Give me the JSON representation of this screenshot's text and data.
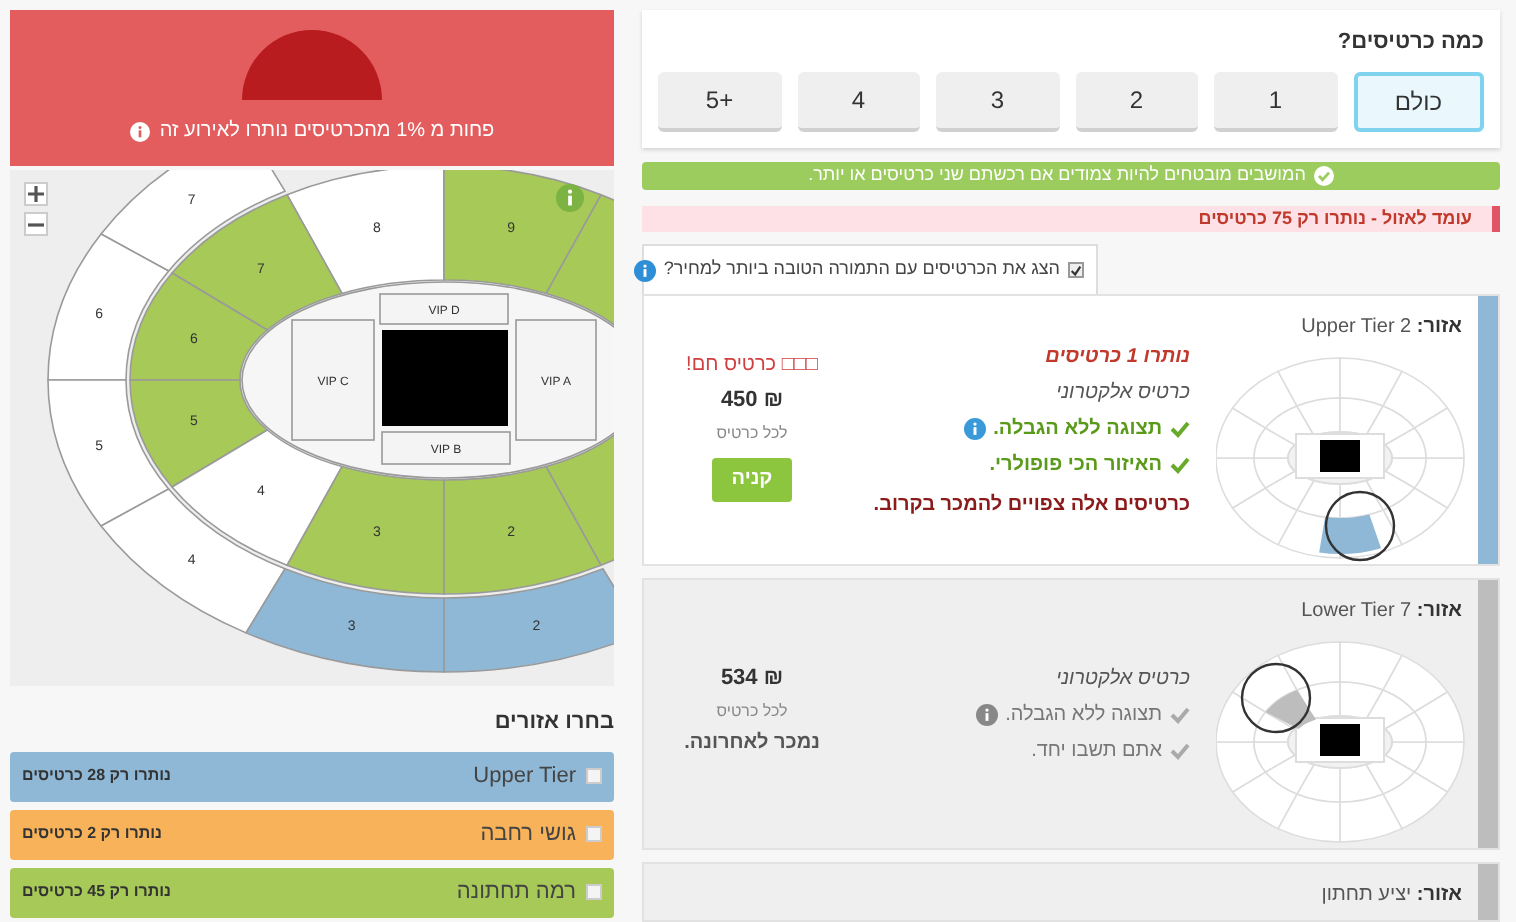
{
  "availability": {
    "text": "פחות מ 1% מהכרטיסים נותרו לאירוע זה"
  },
  "map": {
    "sections": [
      {
        "label": "7",
        "color": "#ffffff"
      },
      {
        "label": "8",
        "color": "#ffffff"
      },
      {
        "label": "9",
        "color": "#a6c957"
      },
      {
        "label": "7",
        "color": "#a6c957"
      },
      {
        "label": "6",
        "color": "#ffffff"
      },
      {
        "label": "6",
        "color": "#a6c957"
      },
      {
        "label": "5",
        "color": "#a6c957"
      },
      {
        "label": "5",
        "color": "#ffffff"
      },
      {
        "label": "4",
        "color": "#ffffff"
      },
      {
        "label": "3",
        "color": "#a6c957"
      },
      {
        "label": "2",
        "color": "#a6c957"
      },
      {
        "label": "4",
        "color": "#ffffff"
      },
      {
        "label": "3",
        "color": "#8fb8d6"
      },
      {
        "label": "2",
        "color": "#8fb8d6"
      }
    ],
    "partial_sections": [
      {
        "color": "#a6c957"
      },
      {
        "color": "#a6c957"
      }
    ],
    "vip": [
      "VIP D",
      "VIP C",
      "VIP A",
      "VIP B"
    ]
  },
  "zones": {
    "title": "בחרו אזורים",
    "items": [
      {
        "name": "Upper Tier",
        "remaining": "נותרו רק 28 כרטיסים",
        "color": "#8fb8d6",
        "checked": false
      },
      {
        "name": "גושי רחבה",
        "remaining": "נותרו רק 2 כרטיסים",
        "color": "#f8b35a",
        "checked": false
      },
      {
        "name": "רמה תחתונה",
        "remaining": "נותרו רק 45 כרטיסים",
        "color": "#a6c957",
        "checked": false
      }
    ]
  },
  "quantity": {
    "title": "כמה כרטיסים?",
    "options": [
      {
        "label": "כולם",
        "selected": true
      },
      {
        "label": "1",
        "selected": false
      },
      {
        "label": "2",
        "selected": false
      },
      {
        "label": "3",
        "selected": false
      },
      {
        "label": "4",
        "selected": false
      },
      {
        "label": "+5",
        "selected": false
      }
    ]
  },
  "adjacent_notice": "המושבים מובטחים להיות צמודים אם רכשתם שני כרטיסים או יותר.",
  "alert": "עומד לאזול - נותרו רק 75 כרטיסים",
  "best_value": {
    "label": "הצג את הכרטיסים עם התמורה הטובה ביותר למחיר?",
    "checked": true
  },
  "listings": [
    {
      "zone_label": "אזור:",
      "zone": "Upper Tier 2",
      "color": "#8fb8d6",
      "highlighted": true,
      "remaining": "נותרו 1 כרטיסים",
      "ticket_type": "כרטיס אלקטרוני",
      "features": [
        {
          "text": "תצוגה ללא הגבלה.",
          "info": true
        },
        {
          "text": "האיזור הכי פופולרי.",
          "info": false
        }
      ],
      "warning": "כרטיסים אלה צפויים להמכר בקרוב.",
      "badge": "□□□ כרטיס חם!",
      "price": "₪ 450",
      "per_ticket": "לכל כרטיס",
      "button": "קניה"
    },
    {
      "zone_label": "אזור:",
      "zone": "Lower Tier 7",
      "color": "#bdbdbd",
      "highlighted": false,
      "ticket_type": "כרטיס אלקטרוני",
      "features": [
        {
          "text": "תצוגה ללא הגבלה.",
          "info": true
        },
        {
          "text": "אתם תשבו יחד.",
          "info": false
        }
      ],
      "price": "₪ 534",
      "per_ticket": "לכל כרטיס",
      "last_sold": "נמכר לאחרונה."
    },
    {
      "zone_label": "אזור:",
      "zone": "יציע תחתון",
      "color": "#bdbdbd",
      "highlighted": false
    }
  ]
}
